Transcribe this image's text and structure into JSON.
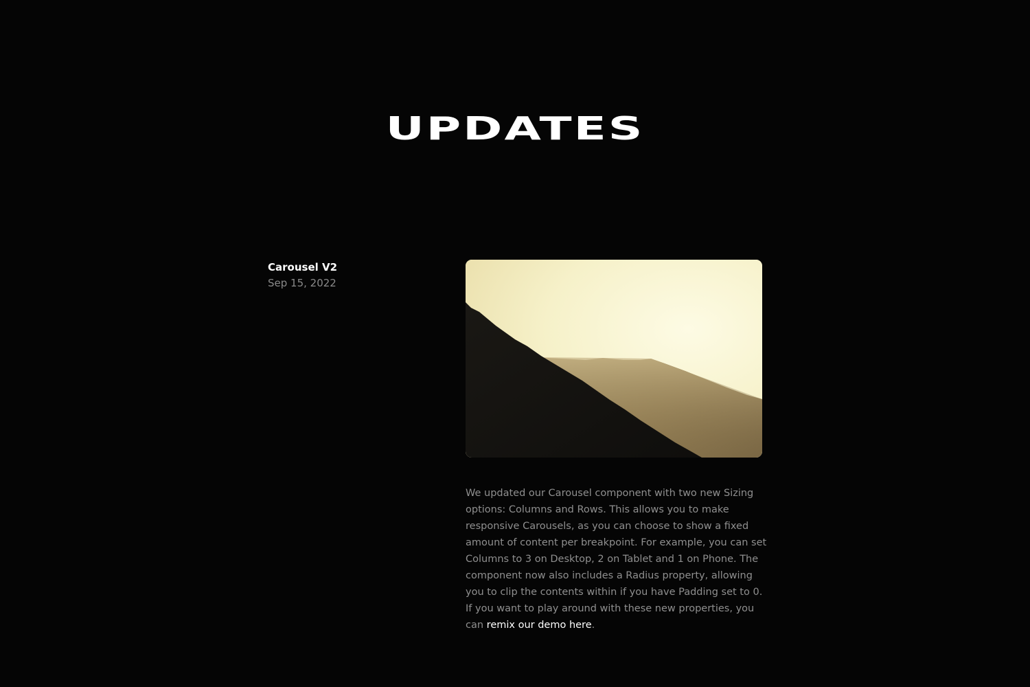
{
  "page": {
    "title": "UPDATES"
  },
  "updates": [
    {
      "title": "Carousel V2",
      "date": "Sep 15, 2022",
      "image": {
        "subject": "sunset-hills-photo"
      },
      "body_text": "We updated our Carousel component with two new Sizing options: Columns and Rows. This allows you to make responsive Carousels, as you can choose to show a fixed amount of content per breakpoint. For example, you can set Columns to 3 on Desktop, 2 on Tablet and 1 on Phone. The component now also includes a Radius property, allowing you to clip the contents within if you have Padding set to 0. If you want to play around with these new properties, you can ",
      "link_text": "remix our demo here",
      "body_end": "."
    }
  ],
  "colors": {
    "background": "#050505",
    "heading": "#ffffff",
    "muted_text": "#8f8f8f",
    "link": "#ffffff",
    "sky": "#f7f3d0"
  }
}
